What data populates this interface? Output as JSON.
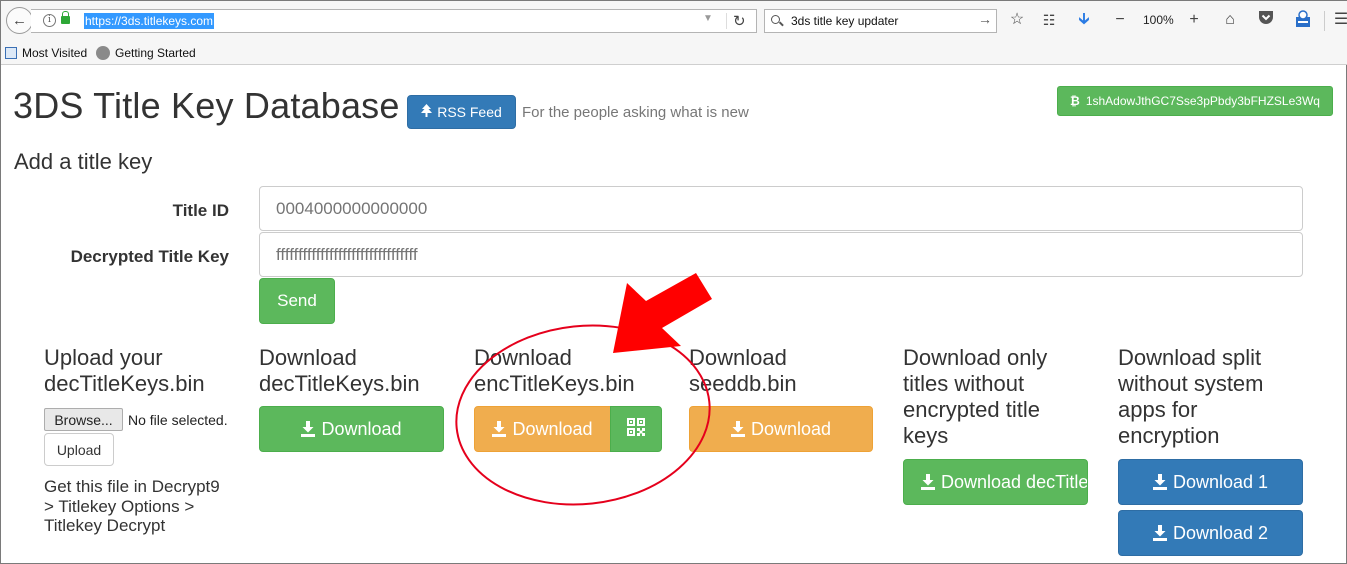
{
  "browser": {
    "url": "https://3ds.titlekeys.com",
    "search_query": "3ds title key updater",
    "zoom": "100%",
    "bookmarks": [
      "Most Visited",
      "Getting Started"
    ]
  },
  "header": {
    "title": "3DS Title Key Database",
    "rss_label": "RSS Feed",
    "tagline": "For the people asking what is new",
    "bitcoin_address": "1shAdowJthGC7Sse3pPbdy3bFHZSLe3Wq"
  },
  "form": {
    "section_title": "Add a title key",
    "title_id_label": "Title ID",
    "title_id_placeholder": "0004000000000000",
    "key_label": "Decrypted Title Key",
    "key_placeholder": "ffffffffffffffffffffffffffffffff",
    "send_label": "Send"
  },
  "columns": {
    "upload": {
      "title": "Upload your decTitleKeys.bin",
      "browse_label": "Browse...",
      "file_status": "No file selected.",
      "upload_label": "Upload",
      "help": "Get this file in Decrypt9 > Titlekey Options > Titlekey Decrypt"
    },
    "dec": {
      "title": "Download decTitleKeys.bin",
      "button": "Download"
    },
    "enc": {
      "title": "Download encTitleKeys.bin",
      "button": "Download"
    },
    "seed": {
      "title": "Download seeddb.bin",
      "button": "Download"
    },
    "only": {
      "title": "Download only titles without encrypted title keys",
      "button": "Download decTitle"
    },
    "split": {
      "title": "Download split without system apps for encryption",
      "button1": "Download 1",
      "button2": "Download 2"
    }
  },
  "colors": {
    "primary": "#337ab7",
    "success": "#5cb85c",
    "warning": "#f0ad4e",
    "annotation": "#e5001c"
  },
  "icons": [
    "back-arrow-icon",
    "info-icon",
    "lock-icon",
    "reload-icon",
    "search-icon",
    "star-icon",
    "reading-list-icon",
    "download-arrow-icon",
    "minus-icon",
    "plus-icon",
    "home-icon",
    "pocket-icon",
    "extension-icon",
    "hamburger-menu-icon",
    "tree-icon",
    "bitcoin-icon",
    "qr-code-icon"
  ]
}
